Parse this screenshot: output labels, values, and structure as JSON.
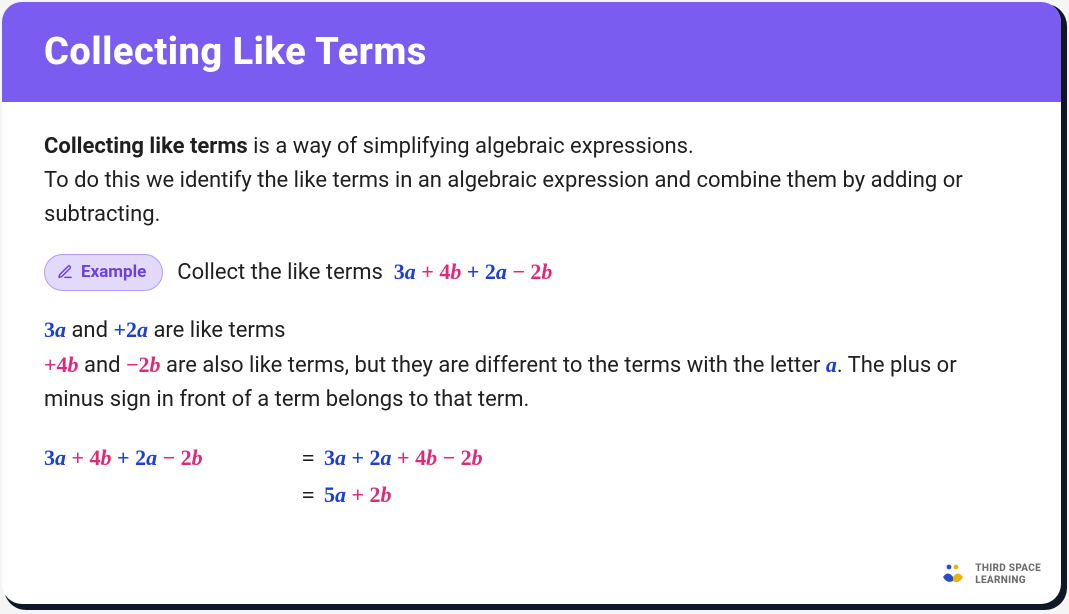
{
  "header": {
    "title": "Collecting Like Terms"
  },
  "intro": {
    "bold": "Collecting like terms",
    "text1": " is a way of simplifying algebraic expressions.",
    "text2": "To do this we identify the like terms in an algebraic expression and combine them by adding or subtracting."
  },
  "example": {
    "badge": "Example",
    "prompt": "Collect the like terms",
    "expr": {
      "p1": "3",
      "p1v": "a",
      "op1": " + ",
      "p2": "4",
      "p2v": "b",
      "op2": " + ",
      "p3": "2",
      "p3v": "a",
      "op3": " − ",
      "p4": "2",
      "p4v": "b"
    }
  },
  "explain": {
    "l1_t1": "3",
    "l1_v1": "a",
    "l1_mid": " and ",
    "l1_t2": "+2",
    "l1_v2": "a",
    "l1_end": " are like terms",
    "l2_t1": "+4",
    "l2_v1": "b",
    "l2_mid": " and ",
    "l2_t2": "−2",
    "l2_v2": "b",
    "l2_end": " are also like terms, but they are different to the terms with the letter ",
    "l2_var": "a",
    "l2_end2": ". The plus or minus sign in front of a term belongs to that term."
  },
  "equation": {
    "lhs": {
      "p1": "3",
      "p1v": "a",
      "op1": " + ",
      "p2": "4",
      "p2v": "b",
      "op2": " + ",
      "p3": "2",
      "p3v": "a",
      "op3": " − ",
      "p4": "2",
      "p4v": "b"
    },
    "eq": "=",
    "rhs1": {
      "p1": "3",
      "p1v": "a",
      "op1": " + ",
      "p2": "2",
      "p2v": "a",
      "op2": " + ",
      "p3": "4",
      "p3v": "b",
      "op3": " − ",
      "p4": "2",
      "p4v": "b"
    },
    "rhs2": {
      "p1": "5",
      "p1v": "a",
      "op1": " + ",
      "p2": "2",
      "p2v": "b"
    }
  },
  "brand": {
    "line1": "THIRD SPACE",
    "line2": "LEARNING"
  },
  "colors": {
    "header": "#7a5cf0",
    "a": "#1e3ed8",
    "b": "#df2a7a"
  }
}
